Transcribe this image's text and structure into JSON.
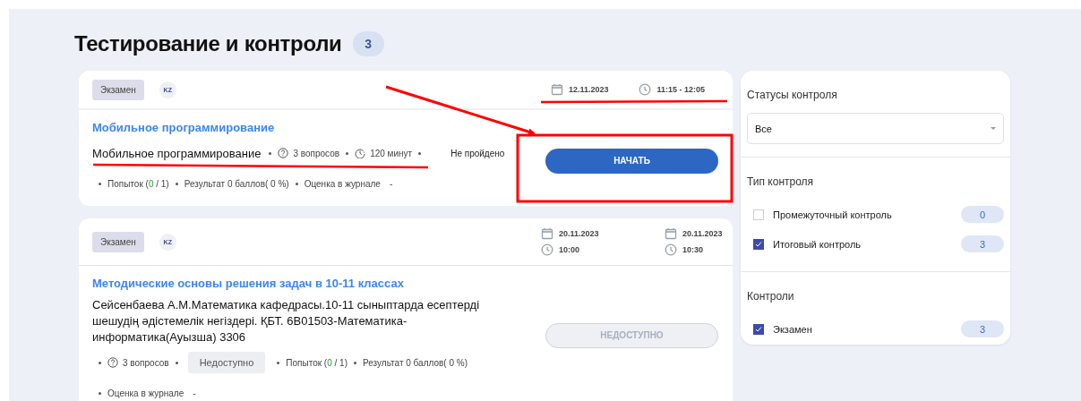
{
  "page": {
    "title": "Тестирование и контроли",
    "count": "3"
  },
  "exams": [
    {
      "type_tag": "Экзамен",
      "lang_tag": "KZ",
      "schedule": [
        {
          "date": "12.11.2023",
          "time": "11:15 - 12:05"
        }
      ],
      "title": "Мобильное программирование",
      "meta_lines": [
        [
          {
            "kind": "subject",
            "text": "Мобильное программирование"
          },
          {
            "kind": "questions",
            "text": "3 вопросов"
          },
          {
            "kind": "duration",
            "text": "120 минут"
          },
          {
            "kind": "status",
            "text": "Не пройдено"
          }
        ],
        [
          {
            "kind": "attempts",
            "label": "Попыток (",
            "used": "0",
            "total": " / 1)"
          },
          {
            "kind": "text",
            "text": "Результат 0 баллов( 0 %)"
          },
          {
            "kind": "grade",
            "label": "Оценка в журнале",
            "value": "-"
          }
        ]
      ],
      "button": {
        "label": "НАЧАТЬ",
        "disabled": false
      }
    },
    {
      "type_tag": "Экзамен",
      "lang_tag": "KZ",
      "schedule": [
        {
          "date": "20.11.2023",
          "time": "10:00"
        },
        {
          "date": "20.11.2023",
          "time": "10:30"
        }
      ],
      "title": "Методические основы решения задач в 10-11 классах",
      "description": "Сейсенбаева А.М.Математика кафедрасы.10-11 сыныптарда есептерді шешудің әдістемелік негіздері. ҚБТ. 6В01503-Математика-информатика(Ауызша) 3306",
      "meta_lines": [
        [
          {
            "kind": "questions",
            "text": "3 вопросов"
          },
          {
            "kind": "chip",
            "text": "Недоступно"
          },
          {
            "kind": "attempts",
            "label": "Попыток (",
            "used": "0",
            "total": " / 1)"
          },
          {
            "kind": "text",
            "text": "Результат 0 баллов( 0 %)"
          }
        ],
        [
          {
            "kind": "grade",
            "label": "Оценка в журнале",
            "value": "-"
          }
        ]
      ],
      "button": {
        "label": "НЕДОСТУПНО",
        "disabled": true
      }
    }
  ],
  "sidebar": {
    "status_filter": {
      "label": "Статусы контроля",
      "value": "Все"
    },
    "groups": [
      {
        "label": "Тип контроля",
        "items": [
          {
            "label": "Промежуточный контроль",
            "checked": false,
            "count": "0"
          },
          {
            "label": "Итоговый контроль",
            "checked": true,
            "count": "3"
          }
        ]
      },
      {
        "label": "Контроли",
        "items": [
          {
            "label": "Экзамен",
            "checked": true,
            "count": "3"
          }
        ]
      }
    ]
  }
}
